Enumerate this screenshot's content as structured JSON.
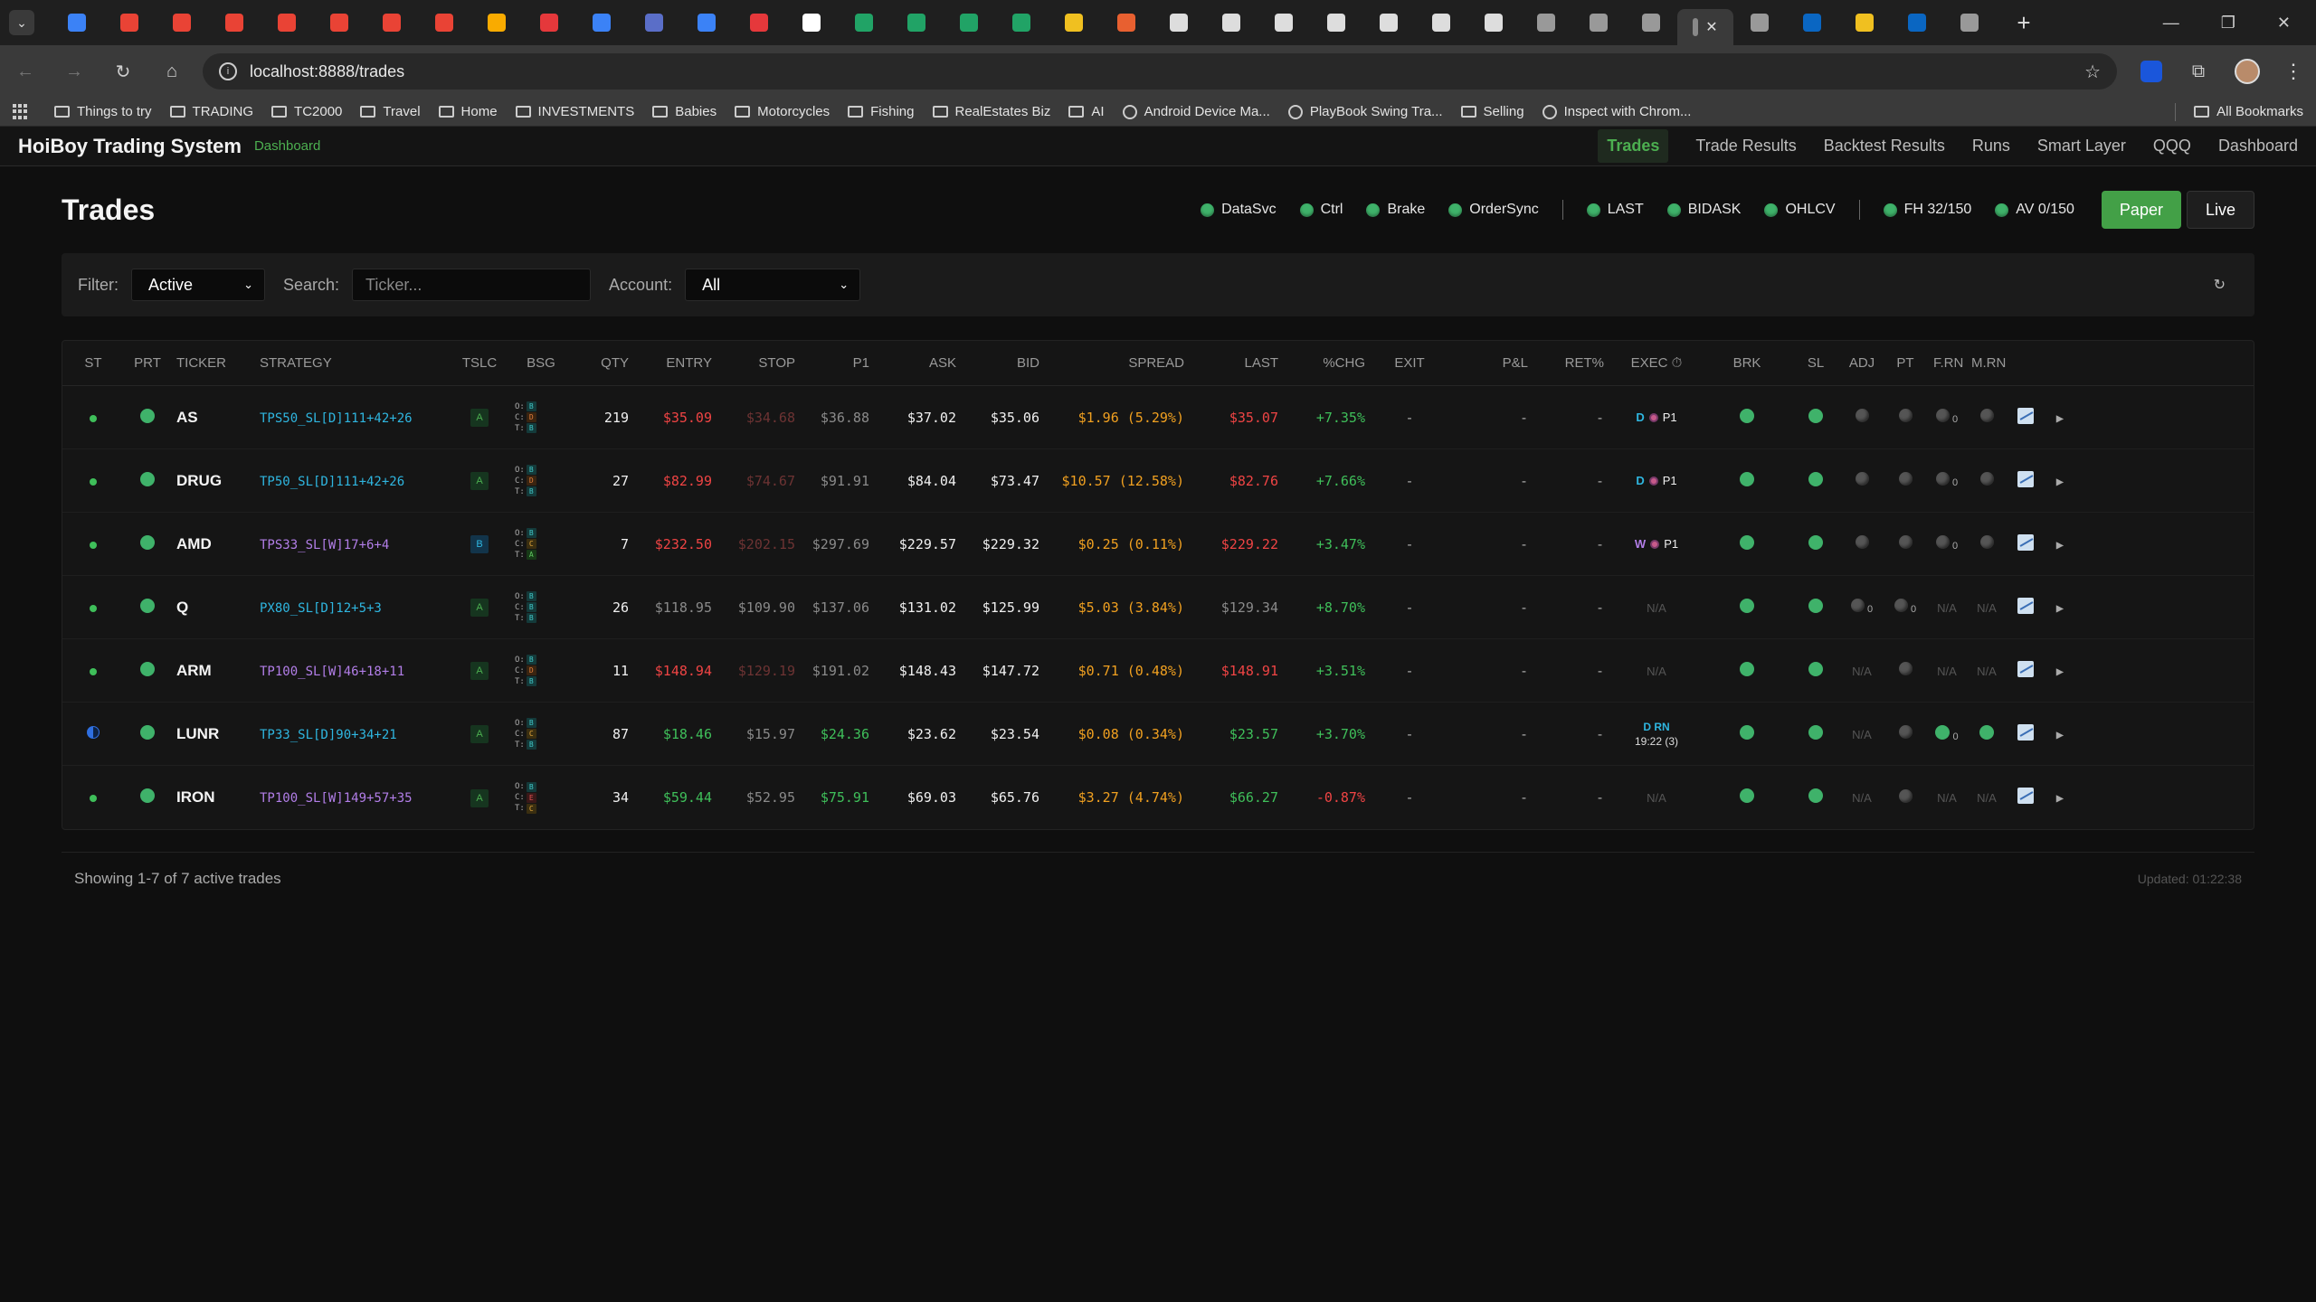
{
  "browser": {
    "url": "localhost:8888/trades",
    "tabs": [
      {
        "color": "#3b82f6"
      },
      {
        "color": "#e94335"
      },
      {
        "color": "#e94335"
      },
      {
        "color": "#e94335"
      },
      {
        "color": "#e94335"
      },
      {
        "color": "#e94335"
      },
      {
        "color": "#e94335"
      },
      {
        "color": "#e94335"
      },
      {
        "color": "#f9ab00"
      },
      {
        "color": "#e5383b"
      },
      {
        "color": "#3b82f6"
      },
      {
        "color": "#5a6ec8"
      },
      {
        "color": "#3b82f6"
      },
      {
        "color": "#e5383b"
      },
      {
        "color": "#ffffff"
      },
      {
        "color": "#21a366"
      },
      {
        "color": "#21a366"
      },
      {
        "color": "#21a366"
      },
      {
        "color": "#21a366"
      },
      {
        "color": "#f0c020"
      },
      {
        "color": "#e86030"
      },
      {
        "color": "#dddddd"
      },
      {
        "color": "#dddddd"
      },
      {
        "color": "#dddddd"
      },
      {
        "color": "#dddddd"
      },
      {
        "color": "#dddddd"
      },
      {
        "color": "#dddddd"
      },
      {
        "color": "#dddddd"
      },
      {
        "color": "#999999"
      },
      {
        "color": "#999999"
      },
      {
        "color": "#999999"
      },
      {
        "color": "#999999"
      },
      {
        "color": "#0a66c2"
      },
      {
        "color": "#f0c020"
      },
      {
        "color": "#0a66c2"
      },
      {
        "color": "#999999"
      }
    ],
    "bookmarks": [
      "Things to try",
      "TRADING",
      "TC2000",
      "Travel",
      "Home",
      "INVESTMENTS",
      "Babies",
      "Motorcycles",
      "Fishing",
      "RealEstates Biz",
      "AI",
      "Android Device Ma...",
      "PlayBook Swing Tra...",
      "Selling",
      "Inspect with Chrom..."
    ],
    "all_bookmarks": "All Bookmarks"
  },
  "app": {
    "title": "HoiBoy Trading System",
    "subtitle": "Dashboard",
    "nav": [
      "Trades",
      "Trade Results",
      "Backtest Results",
      "Runs",
      "Smart Layer",
      "QQQ",
      "Dashboard"
    ]
  },
  "page": {
    "title": "Trades",
    "status_group1": [
      "DataSvc",
      "Ctrl",
      "Brake",
      "OrderSync"
    ],
    "status_group2": [
      "LAST",
      "BIDASK",
      "OHLCV"
    ],
    "status_group3": [
      "FH 32/150",
      "AV 0/150"
    ],
    "mode_paper": "Paper",
    "mode_live": "Live"
  },
  "filters": {
    "filter_label": "Filter:",
    "filter_value": "Active",
    "search_label": "Search:",
    "search_placeholder": "Ticker...",
    "account_label": "Account:",
    "account_value": "All",
    "refresh_icon": "↻"
  },
  "table": {
    "headers": [
      "ST",
      "PRT",
      "TICKER",
      "STRATEGY",
      "TSLC",
      "BSG",
      "QTY",
      "ENTRY",
      "STOP",
      "P1",
      "ASK",
      "BID",
      "SPREAD",
      "LAST",
      "%CHG",
      "EXIT",
      "P&L",
      "RET%",
      "EXEC ⏱",
      "BRK",
      "SL",
      "ADJ",
      "PT",
      "F.RN",
      "M.RN"
    ],
    "rows": [
      {
        "ticker": "AS",
        "strategy": "TPS50_SL[D]111+42+26",
        "tslc": "A",
        "qty": "219",
        "entry": "$35.09",
        "stop": "$34.68",
        "p1": "$36.88",
        "ask": "$37.02",
        "bid": "$35.06",
        "spread": "$1.96 (5.29%)",
        "last": "$35.07",
        "chg": "+7.35%",
        "exit": "-",
        "pnl": "-",
        "ret": "-",
        "exec_letter": "D",
        "exec_target": "P1"
      },
      {
        "ticker": "DRUG",
        "strategy": "TP50_SL[D]111+42+26",
        "tslc": "A",
        "qty": "27",
        "entry": "$82.99",
        "stop": "$74.67",
        "p1": "$91.91",
        "ask": "$84.04",
        "bid": "$73.47",
        "spread": "$10.57 (12.58%)",
        "last": "$82.76",
        "chg": "+7.66%",
        "exit": "-",
        "pnl": "-",
        "ret": "-",
        "exec_letter": "D",
        "exec_target": "P1"
      },
      {
        "ticker": "AMD",
        "strategy": "TPS33_SL[W]17+6+4",
        "tslc": "B",
        "qty": "7",
        "entry": "$232.50",
        "stop": "$202.15",
        "p1": "$297.69",
        "ask": "$229.57",
        "bid": "$229.32",
        "spread": "$0.25 (0.11%)",
        "last": "$229.22",
        "chg": "+3.47%",
        "exit": "-",
        "pnl": "-",
        "ret": "-",
        "exec_letter": "W",
        "exec_target": "P1"
      },
      {
        "ticker": "Q",
        "strategy": "PX80_SL[D]12+5+3",
        "tslc": "A",
        "qty": "26",
        "entry": "$118.95",
        "stop": "$109.90",
        "p1": "$137.06",
        "ask": "$131.02",
        "bid": "$125.99",
        "spread": "$5.03 (3.84%)",
        "last": "$129.34",
        "chg": "+8.70%",
        "exit": "-",
        "pnl": "-",
        "ret": "-",
        "exec_na": "N/A"
      },
      {
        "ticker": "ARM",
        "strategy": "TP100_SL[W]46+18+11",
        "tslc": "A",
        "qty": "11",
        "entry": "$148.94",
        "stop": "$129.19",
        "p1": "$191.02",
        "ask": "$148.43",
        "bid": "$147.72",
        "spread": "$0.71 (0.48%)",
        "last": "$148.91",
        "chg": "+3.51%",
        "exit": "-",
        "pnl": "-",
        "ret": "-",
        "exec_na": "N/A"
      },
      {
        "ticker": "LUNR",
        "strategy": "TP33_SL[D]90+34+21",
        "tslc": "A",
        "qty": "87",
        "entry": "$18.46",
        "stop": "$15.97",
        "p1": "$24.36",
        "ask": "$23.62",
        "bid": "$23.54",
        "spread": "$0.08 (0.34%)",
        "last": "$23.57",
        "chg": "+3.70%",
        "exit": "-",
        "pnl": "-",
        "ret": "-",
        "exec_top": "D RN",
        "exec_bot": "19:22 (3)"
      },
      {
        "ticker": "IRON",
        "strategy": "TP100_SL[W]149+57+35",
        "tslc": "A",
        "qty": "34",
        "entry": "$59.44",
        "stop": "$52.95",
        "p1": "$75.91",
        "ask": "$69.03",
        "bid": "$65.76",
        "spread": "$3.27 (4.74%)",
        "last": "$66.27",
        "chg": "-0.87%",
        "exit": "-",
        "pnl": "-",
        "ret": "-",
        "exec_na": "N/A"
      }
    ],
    "na": "N/A",
    "zero": "0"
  },
  "footer": {
    "showing": "Showing 1-7 of 7 active trades",
    "updated": "Updated: 01:22:38"
  }
}
